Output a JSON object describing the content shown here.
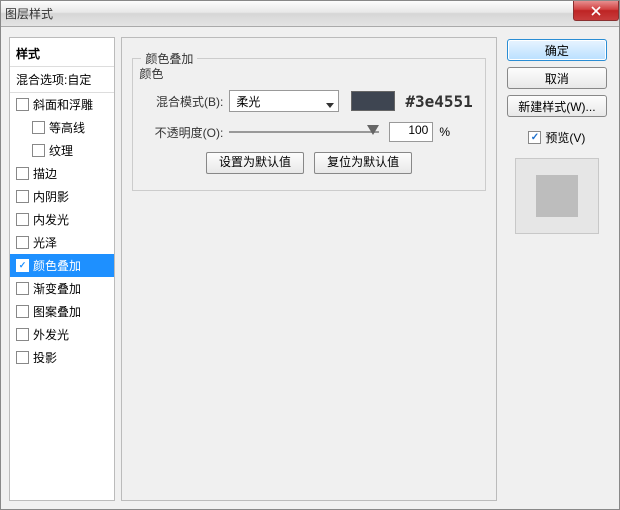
{
  "title": "图层样式",
  "left": {
    "header": "样式",
    "sub": "混合选项:自定",
    "items": [
      {
        "label": "斜面和浮雕",
        "checked": false,
        "indent": false,
        "selected": false
      },
      {
        "label": "等高线",
        "checked": false,
        "indent": true,
        "selected": false
      },
      {
        "label": "纹理",
        "checked": false,
        "indent": true,
        "selected": false
      },
      {
        "label": "描边",
        "checked": false,
        "indent": false,
        "selected": false
      },
      {
        "label": "内阴影",
        "checked": false,
        "indent": false,
        "selected": false
      },
      {
        "label": "内发光",
        "checked": false,
        "indent": false,
        "selected": false
      },
      {
        "label": "光泽",
        "checked": false,
        "indent": false,
        "selected": false
      },
      {
        "label": "颜色叠加",
        "checked": true,
        "indent": false,
        "selected": true
      },
      {
        "label": "渐变叠加",
        "checked": false,
        "indent": false,
        "selected": false
      },
      {
        "label": "图案叠加",
        "checked": false,
        "indent": false,
        "selected": false
      },
      {
        "label": "外发光",
        "checked": false,
        "indent": false,
        "selected": false
      },
      {
        "label": "投影",
        "checked": false,
        "indent": false,
        "selected": false
      }
    ]
  },
  "center": {
    "panel_title": "颜色叠加",
    "group_title": "颜色",
    "blend_label": "混合模式(B):",
    "blend_value": "柔光",
    "color_hex": "#3e4551",
    "opacity_label": "不透明度(O):",
    "opacity_value": "100",
    "opacity_unit": "%",
    "btn_set_default": "设置为默认值",
    "btn_reset_default": "复位为默认值"
  },
  "right": {
    "ok": "确定",
    "cancel": "取消",
    "new_style": "新建样式(W)...",
    "preview_label": "预览(V)"
  }
}
